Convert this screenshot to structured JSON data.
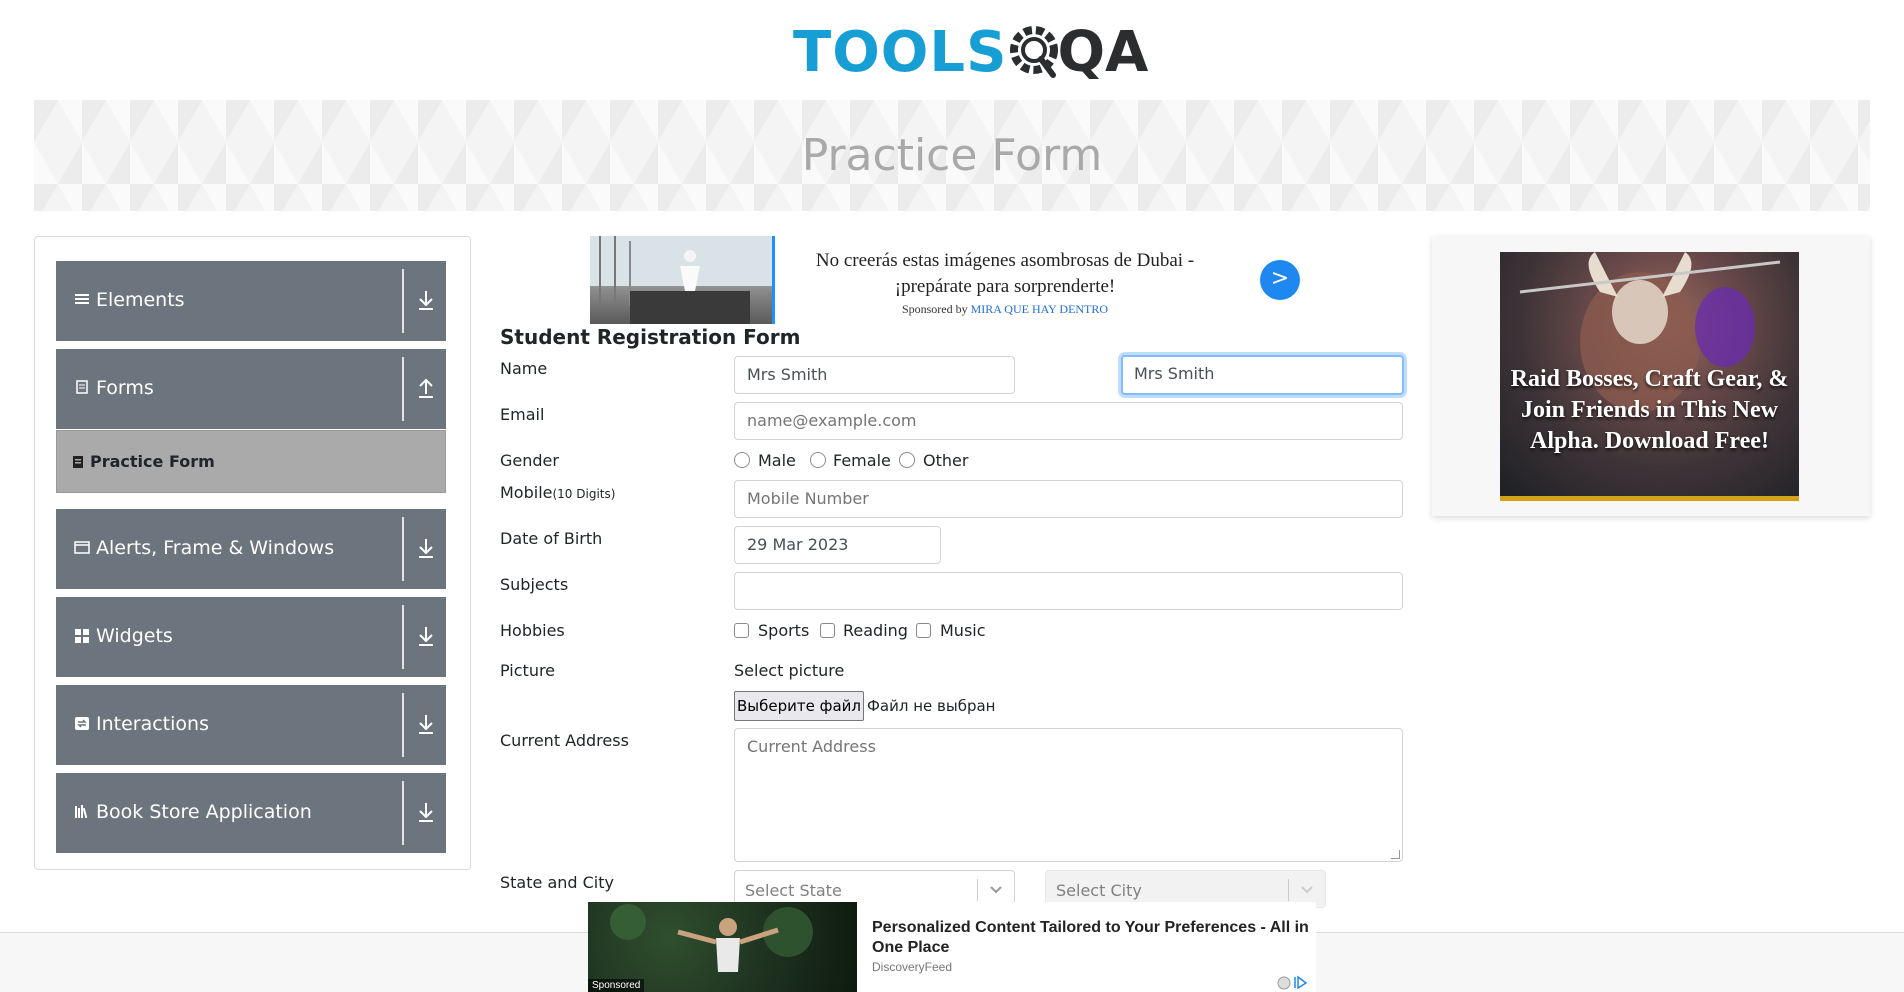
{
  "brand": {
    "logo_left": "TOOLS",
    "logo_right": "QA"
  },
  "banner": {
    "title": "Practice Form"
  },
  "sidebar": {
    "groups": [
      {
        "label": "Elements",
        "icon": "menu-icon",
        "arrow": "download-icon"
      },
      {
        "label": "Forms",
        "icon": "document-icon",
        "arrow": "upload-icon"
      },
      {
        "label": "Alerts, Frame & Windows",
        "icon": "window-icon",
        "arrow": "download-icon"
      },
      {
        "label": "Widgets",
        "icon": "widgets-icon",
        "arrow": "download-icon"
      },
      {
        "label": "Interactions",
        "icon": "interactions-icon",
        "arrow": "download-icon"
      },
      {
        "label": "Book Store Application",
        "icon": "books-icon",
        "arrow": "download-icon"
      }
    ],
    "forms_items": [
      {
        "label": "Practice Form",
        "icon": "practice-form-icon"
      }
    ]
  },
  "ad_top": {
    "text": "No creerás estas imágenes asombrosas de Dubai - ¡prepárate para sorprenderte!",
    "sponsored_prefix": "Sponsored by",
    "brand": "MIRA QUE HAY DENTRO",
    "button": ">"
  },
  "form": {
    "title": "Student Registration Form",
    "name_label": "Name",
    "first_name_value": "Mrs Smith",
    "last_name_value": "Mrs Smith",
    "email_label": "Email",
    "email_placeholder": "name@example.com",
    "gender_label": "Gender",
    "gender_options": [
      "Male",
      "Female",
      "Other"
    ],
    "mobile_label": "Mobile",
    "mobile_hint": "(10 Digits)",
    "mobile_placeholder": "Mobile Number",
    "dob_label": "Date of Birth",
    "dob_value": "29 Mar 2023",
    "subjects_label": "Subjects",
    "hobbies_label": "Hobbies",
    "hobbies_options": [
      "Sports",
      "Reading",
      "Music"
    ],
    "picture_label": "Picture",
    "picture_select_label": "Select picture",
    "file_button": "Выберите файл",
    "file_none": "Файл не выбран",
    "address_label": "Current Address",
    "address_placeholder": "Current Address",
    "state_city_label": "State and City",
    "state_placeholder": "Select State",
    "city_placeholder": "Select City"
  },
  "ad_right": {
    "text": "Raid Bosses, Craft Gear, & Join Friends in This New Alpha. Download Free!"
  },
  "ad_bottom": {
    "sponsored": "Sponsored",
    "title": "Personalized Content Tailored to Your Preferences - All in One Place",
    "source": "DiscoveryFeed"
  },
  "colors": {
    "accent": "#169ed5",
    "sidebar_bg": "#6c757d",
    "active_item": "#aaaaaa",
    "focus": "#80bdff"
  }
}
